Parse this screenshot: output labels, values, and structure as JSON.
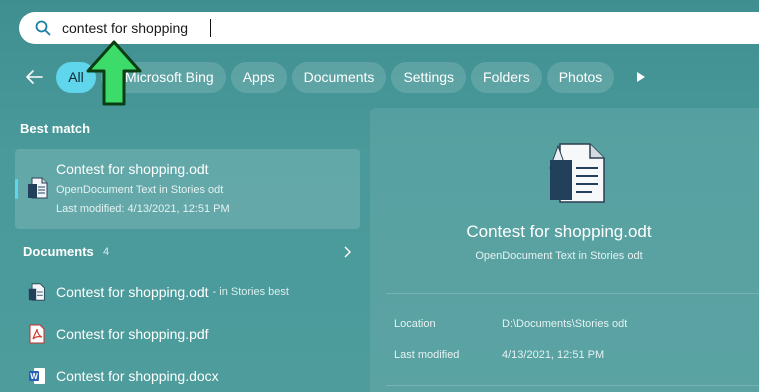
{
  "search": {
    "value": "contest for shopping",
    "placeholder": ""
  },
  "filters": {
    "back_label": "",
    "chips": [
      "All",
      "Microsoft Bing",
      "Apps",
      "Documents",
      "Settings",
      "Folders",
      "Photos"
    ]
  },
  "best_match": {
    "heading": "Best match",
    "name": "Contest for shopping.odt",
    "type": "OpenDocument Text in Stories odt",
    "modified": "Last modified: 4/13/2021, 12:51 PM"
  },
  "documents": {
    "heading": "Documents",
    "count": "4",
    "items": [
      {
        "name": "Contest for shopping.odt",
        "sub": "- in Stories best",
        "icon": "odt-icon"
      },
      {
        "name": "Contest for shopping.pdf",
        "sub": "",
        "icon": "pdf-icon"
      },
      {
        "name": "Contest for shopping.docx",
        "sub": "",
        "icon": "word-icon"
      }
    ]
  },
  "preview": {
    "title": "Contest for shopping.odt",
    "subtitle": "OpenDocument Text in Stories odt",
    "location_label": "Location",
    "location_value": "D:\\Documents\\Stories odt",
    "modified_label": "Last modified",
    "modified_value": "4/13/2021, 12:51 PM"
  },
  "colors": {
    "accent": "#5fd6ec",
    "background": "#4a9a9b",
    "arrow": "#3ddc6a"
  }
}
